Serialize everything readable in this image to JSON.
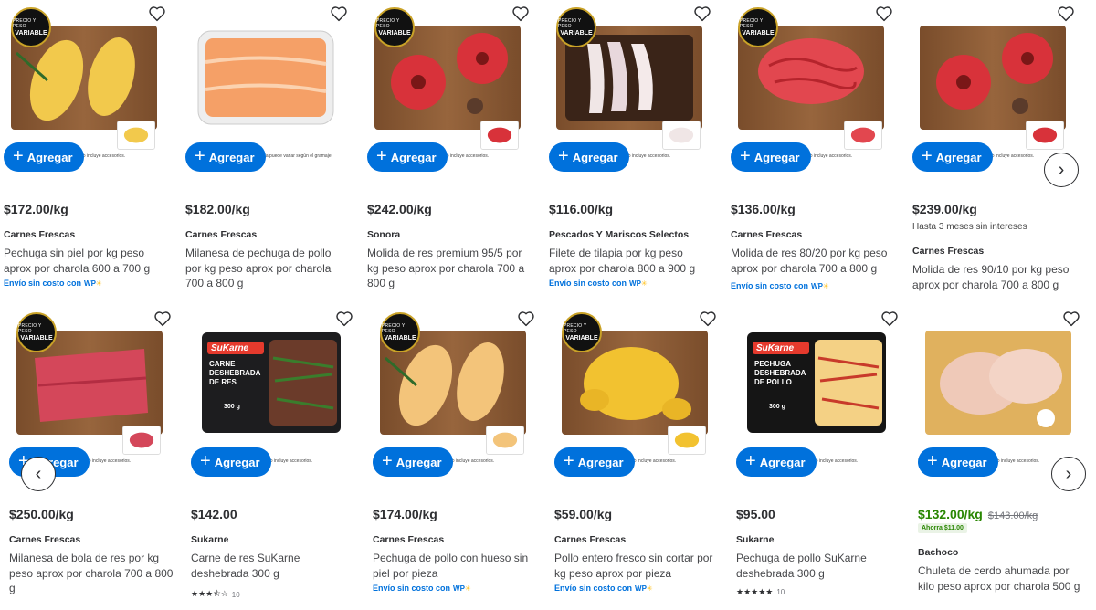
{
  "common": {
    "add_label": "Agregar",
    "accessories_note": "no incluye accesorios.",
    "badge_line1": "PRECIO Y PESO",
    "badge_line2": "VARIABLE",
    "shipping_label": "Envío sin costo con"
  },
  "row1": [
    {
      "price": "$172.00/kg",
      "brand": "Carnes Frescas",
      "title": "Pechuga sin piel por kg peso aprox por charola 600 a 700 g",
      "has_badge": true,
      "shipping": true,
      "image": "chicken-breast-on-board",
      "accent": "#f2c94c"
    },
    {
      "price": "$182.00/kg",
      "brand": "Carnes Frescas",
      "title": "Milanesa de pechuga de pollo por kg peso aprox por charola 700 a 800 g",
      "note": "ola puede variar según el gramaje.",
      "has_badge": false,
      "image": "chicken-fillets-tray",
      "accent": "#f5a067"
    },
    {
      "price": "$242.00/kg",
      "brand": "Sonora",
      "title": "Molida de res premium 95/5 por kg peso aprox por charola 700 a 800 g",
      "has_badge": true,
      "image": "ground-beef-on-board",
      "accent": "#d8323a"
    },
    {
      "price": "$116.00/kg",
      "brand": "Pescados Y Mariscos Selectos",
      "title": "Filete de tilapia por kg peso aprox por charola 800 a 900 g",
      "has_badge": true,
      "shipping": true,
      "image": "tilapia-fillets-on-board",
      "accent": "#f0e6e6"
    },
    {
      "price": "$136.00/kg",
      "brand": "Carnes Frescas",
      "title": "Molida de res 80/20 por kg peso aprox por charola 700 a 800 g",
      "has_badge": true,
      "shipping": true,
      "image": "ground-beef-pile",
      "accent": "#e2474f"
    },
    {
      "price": "$239.00/kg",
      "promo": "Hasta 3 meses sin intereses",
      "brand": "Carnes Frescas",
      "title": "Molida de res 90/10 por kg peso aprox por charola 700 a 800 g",
      "has_badge": false,
      "image": "ground-beef-on-board",
      "accent": "#d8323a"
    }
  ],
  "row2": [
    {
      "price": "$250.00/kg",
      "brand": "Carnes Frescas",
      "title": "Milanesa de bola de res por kg peso aprox por charola 700 a 800 g",
      "has_badge": true,
      "image": "beef-steaks-on-board",
      "accent": "#d4475a"
    },
    {
      "price": "$142.00",
      "brand": "Sukarne",
      "title": "Carne de res SuKarne deshebrada 300 g",
      "has_badge": false,
      "rating": 3.5,
      "rating_count": "10",
      "image": "sukarne-shredded-beef-pack",
      "accent": "#6b3b2a",
      "pack_brand": "SuKarne",
      "pack_text": "CARNE DESHEBRADA DE RES",
      "pack_weight": "300 g"
    },
    {
      "price": "$174.00/kg",
      "brand": "Carnes Frescas",
      "title": "Pechuga de pollo con hueso sin piel por pieza",
      "has_badge": true,
      "shipping": true,
      "image": "chicken-breast-bone-on-board",
      "accent": "#f3c47a"
    },
    {
      "price": "$59.00/kg",
      "brand": "Carnes Frescas",
      "title": "Pollo entero fresco sin cortar por kg peso aprox por pieza",
      "has_badge": true,
      "shipping": true,
      "image": "whole-chicken-on-board",
      "accent": "#f2c230"
    },
    {
      "price": "$95.00",
      "brand": "Sukarne",
      "title": "Pechuga de pollo SuKarne deshebrada 300 g",
      "has_badge": false,
      "rating": 5,
      "rating_count": "10",
      "image": "sukarne-shredded-chicken-pack",
      "accent": "#f5d08a",
      "pack_brand": "SuKarne",
      "pack_text": "PECHUGA DESHEBRADA DE POLLO",
      "pack_weight": "300 g"
    },
    {
      "price": "$132.00/kg",
      "was_price": "$143.00/kg",
      "savings": "Ahorra $11.00",
      "brand": "Bachoco",
      "title": "Chuleta de cerdo ahumada por kilo peso aprox por charola 500 g",
      "has_badge": false,
      "image": "smoked-pork-chops-on-board",
      "accent": "#efc9b8"
    }
  ],
  "nav": {
    "next_icon": "chevron-right-icon",
    "prev_icon": "chevron-left-icon"
  }
}
